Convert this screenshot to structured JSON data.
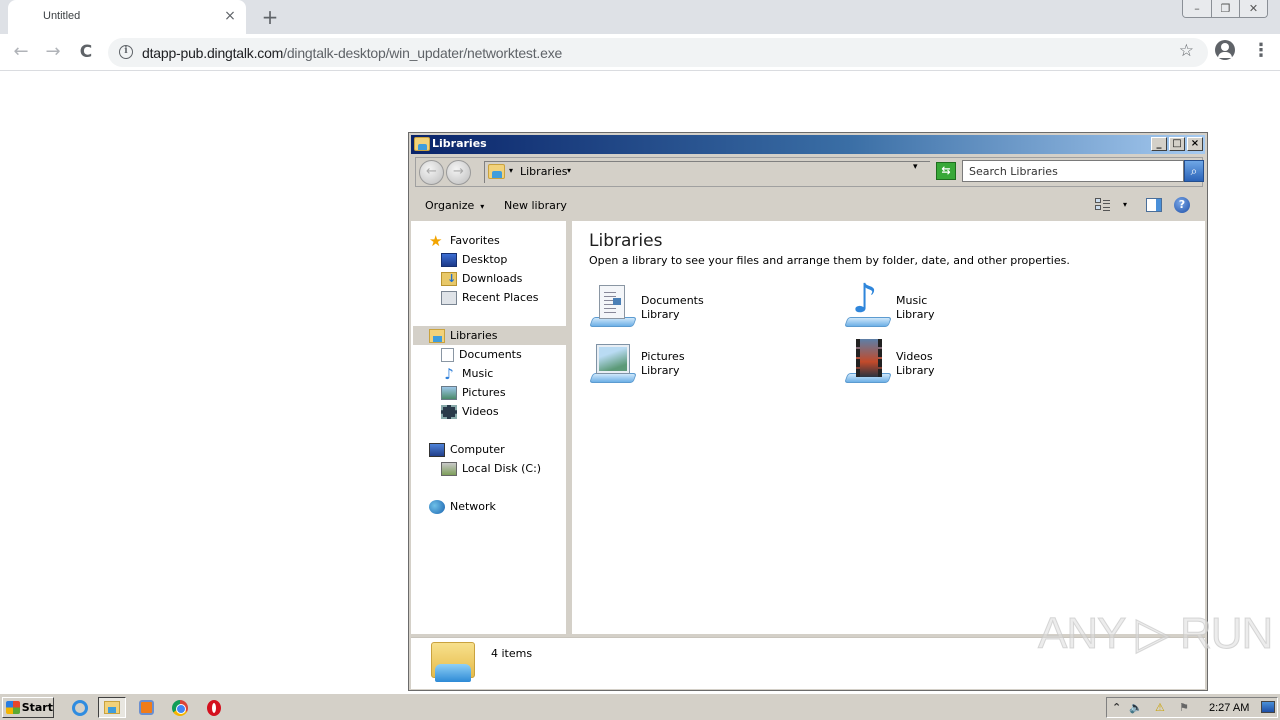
{
  "browser": {
    "tab_title": "Untitled",
    "tab_close_glyph": "×",
    "new_tab_glyph": "+",
    "window_controls": [
      "–",
      "❐",
      "✕"
    ],
    "nav": {
      "back": "←",
      "forward": "→",
      "reload": "C"
    },
    "url_host": "dtapp-pub.dingtalk.com",
    "url_path": "/dingtalk-desktop/win_updater/networktest.exe",
    "info_glyph": "i",
    "star_glyph": "☆",
    "menu_glyph": "⋮"
  },
  "explorer": {
    "title": "Libraries",
    "title_buttons": [
      "_",
      "□",
      "×"
    ],
    "back_glyph": "←",
    "forward_glyph": "→",
    "breadcrumb": "Libraries",
    "refresh_glyph": "⇆",
    "search_placeholder": "Search Libraries",
    "search_glyph": "⌕",
    "commands": {
      "organize": "Organize",
      "new_library": "New library"
    },
    "caret": "▾",
    "help_glyph": "?",
    "nav_pane": {
      "favorites": "Favorites",
      "favorites_items": [
        "Desktop",
        "Downloads",
        "Recent Places"
      ],
      "libraries": "Libraries",
      "libraries_items": [
        "Documents",
        "Music",
        "Pictures",
        "Videos"
      ],
      "computer": "Computer",
      "computer_items": [
        "Local Disk (C:)"
      ],
      "network": "Network"
    },
    "content": {
      "heading": "Libraries",
      "subheading": "Open a library to see your files and arrange them by folder, date, and other properties.",
      "libraries": [
        {
          "name": "Documents",
          "kind": "Library",
          "icon": "documents-library-icon"
        },
        {
          "name": "Music",
          "kind": "Library",
          "icon": "music-library-icon"
        },
        {
          "name": "Pictures",
          "kind": "Library",
          "icon": "pictures-library-icon"
        },
        {
          "name": "Videos",
          "kind": "Library",
          "icon": "videos-library-icon"
        }
      ],
      "music_glyph": "♪"
    },
    "status": "4 items"
  },
  "watermark": "ANY ▷ RUN",
  "taskbar": {
    "start_label": "Start",
    "tray_glyphs": {
      "expand": "⌃",
      "volume": "🔈",
      "network": "⚠",
      "flag": "⚑"
    },
    "clock": "2:27 AM"
  }
}
